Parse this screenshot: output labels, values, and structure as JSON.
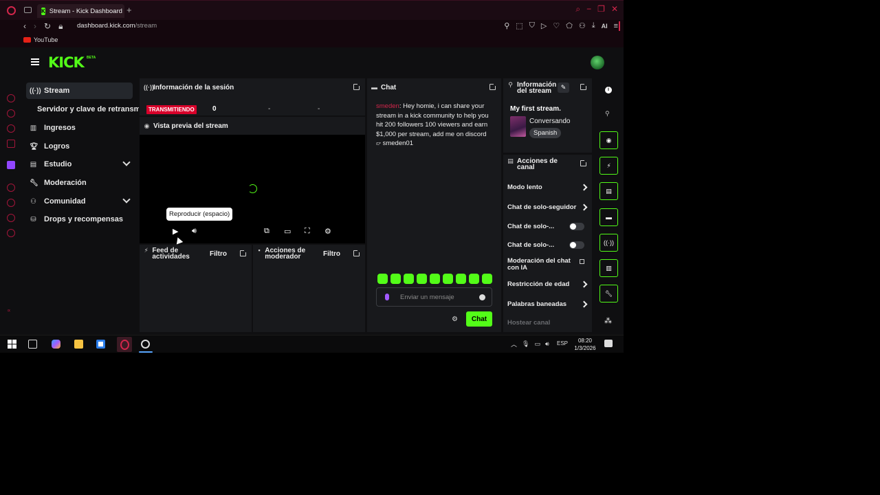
{
  "browser": {
    "tab_title": "Stream - Kick Dashboard",
    "new_tab": "+",
    "url_host": "dashboard.kick.com",
    "url_path": "/stream",
    "ai_label": "AI",
    "bookmark_youtube": "YouTube"
  },
  "header": {
    "logo": "KICK",
    "beta": "BETA"
  },
  "left_nav": {
    "items": [
      {
        "label": "Stream",
        "icon": "broadcast-icon"
      },
      {
        "label": "Servidor y clave de retransmisión"
      },
      {
        "label": "Ingresos",
        "icon": "chart-icon"
      },
      {
        "label": "Logros",
        "icon": "trophy-icon"
      },
      {
        "label": "Estudio",
        "icon": "studio-icon"
      },
      {
        "label": "Moderación",
        "icon": "wrench-icon"
      },
      {
        "label": "Comunidad",
        "icon": "community-icon"
      },
      {
        "label": "Drops y recompensas",
        "icon": "drops-icon"
      }
    ]
  },
  "session": {
    "title": "Información de la sesión",
    "live_badge": "TRANSMITIENDO",
    "viewers": "0",
    "stat2": "-",
    "stat3": "-"
  },
  "preview": {
    "title": "Vista previa del stream",
    "tooltip": "Reproducir (espacio)"
  },
  "activity_feed": {
    "title": "Feed de actividades",
    "filter": "Filtro"
  },
  "mod_actions": {
    "title": "Acciones de moderador",
    "filter": "Filtro"
  },
  "chat": {
    "title": "Chat",
    "message_user": "smeden",
    "message_text": ": Hey homie, i can share your stream in a kick community to help you hit 200 followers 100 viewers and earn $1,000 per stream, add me on discord",
    "message_discord": "smeden01",
    "placeholder": "Enviar un mensaje",
    "send_label": "Chat"
  },
  "stream_info": {
    "title": "Información del stream",
    "stream_title": "My first stream.",
    "category": "Conversando",
    "language": "Spanish"
  },
  "channel_actions": {
    "title": "Acciones de canal",
    "items": [
      {
        "label": "Modo lento",
        "control": "chevron"
      },
      {
        "label": "Chat de solo-seguidor",
        "control": "chevron"
      },
      {
        "label": "Chat de solo-...",
        "control": "toggle",
        "on": false
      },
      {
        "label": "Chat de solo-...",
        "control": "toggle",
        "on": false
      },
      {
        "label": "Moderación del chat con IA",
        "control": "external"
      },
      {
        "label": "Restricción de edad",
        "control": "chevron"
      },
      {
        "label": "Palabras baneadas",
        "control": "chevron"
      }
    ],
    "host_channel": "Hostear canal"
  },
  "taskbar": {
    "lang": "ESP",
    "time": "08:20",
    "date": "1/3/2026"
  },
  "colors": {
    "kick_green": "#53fc18",
    "opera_red": "#d2264b",
    "live_red": "#d8002a"
  }
}
